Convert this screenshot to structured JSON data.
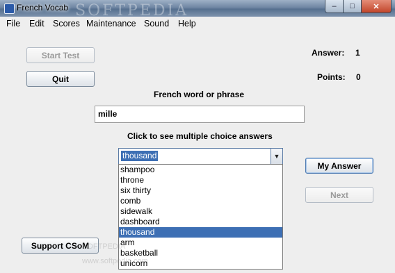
{
  "window": {
    "title": "French Vocab",
    "watermark": "SOFTPEDIA",
    "controls": {
      "minimize": "–",
      "maximize": "□",
      "close": "✕"
    }
  },
  "menu": [
    {
      "label": "File"
    },
    {
      "label": "Edit"
    },
    {
      "label": "Scores"
    },
    {
      "label": "Maintenance"
    },
    {
      "label": "Sound"
    },
    {
      "label": "Help"
    }
  ],
  "buttons": {
    "start_test": "Start Test",
    "quit": "Quit",
    "my_answer": "My Answer",
    "next": "Next",
    "support": "Support CSoM"
  },
  "status": {
    "answer_label": "Answer:",
    "answer_value": "1",
    "points_label": "Points:",
    "points_value": "0"
  },
  "prompt": {
    "heading": "French word or phrase",
    "value": "mille"
  },
  "choices": {
    "heading": "Click to see multiple choice answers",
    "selected": "thousand",
    "options": [
      "shampoo",
      "throne",
      "six thirty",
      "comb",
      "sidewalk",
      "dashboard",
      "thousand",
      "arm",
      "basketball",
      "unicorn"
    ]
  },
  "overlay_text": {
    "softpedia_small": "SOFTPEDIA",
    "softpedia_url": "www.softpedia.com"
  },
  "colors": {
    "selection": "#3d6fb4",
    "window_bg": "#eeeeee",
    "titlebar": "#6f86a3"
  }
}
